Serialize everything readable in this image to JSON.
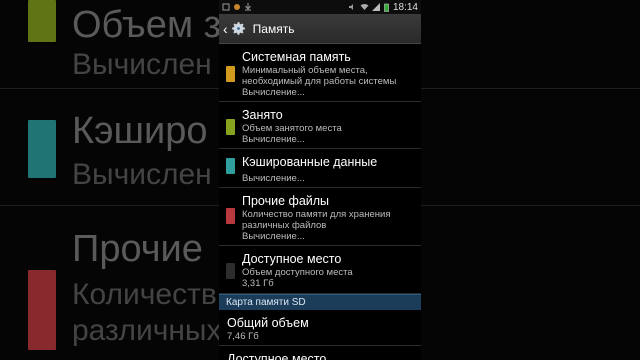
{
  "background": {
    "blocks": [
      {
        "title": "Объем зана",
        "sub": "Вычислен",
        "color": "#7f9a1c"
      },
      {
        "title": "Кэширо        нные",
        "sub": "Вычислен",
        "color": "#2a9a9a"
      },
      {
        "title": "Прочие",
        "sub": "Количеств        хранения",
        "sub2": "различных",
        "color": "#b4353b"
      }
    ]
  },
  "status_bar": {
    "time": "18:14"
  },
  "action_bar": {
    "title": "Память"
  },
  "items": [
    {
      "title": "Системная память",
      "lines": [
        "Минимальный объем места,",
        "необходимый для работы системы",
        "Вычисление..."
      ],
      "color": "#d19a1f"
    },
    {
      "title": "Занято",
      "lines": [
        "Объем занятого места",
        "Вычисление..."
      ],
      "color": "#86a21f"
    },
    {
      "title": "Кэшированные данные",
      "lines": [
        "Вычисление..."
      ],
      "color": "#2f9e9c"
    },
    {
      "title": "Прочие файлы",
      "lines": [
        "Количество памяти для хранения",
        "различных файлов",
        "Вычисление..."
      ],
      "color": "#b83a3f"
    },
    {
      "title": "Доступное место",
      "lines": [
        "Объем доступного места",
        "3,31 Гб"
      ],
      "color": "#2c2c2c"
    }
  ],
  "sd_section": {
    "title": "Карта памяти SD"
  },
  "sd_items": [
    {
      "title": "Общий объем",
      "value": "7,46 Гб"
    },
    {
      "title": "Доступное место",
      "value": ""
    }
  ]
}
